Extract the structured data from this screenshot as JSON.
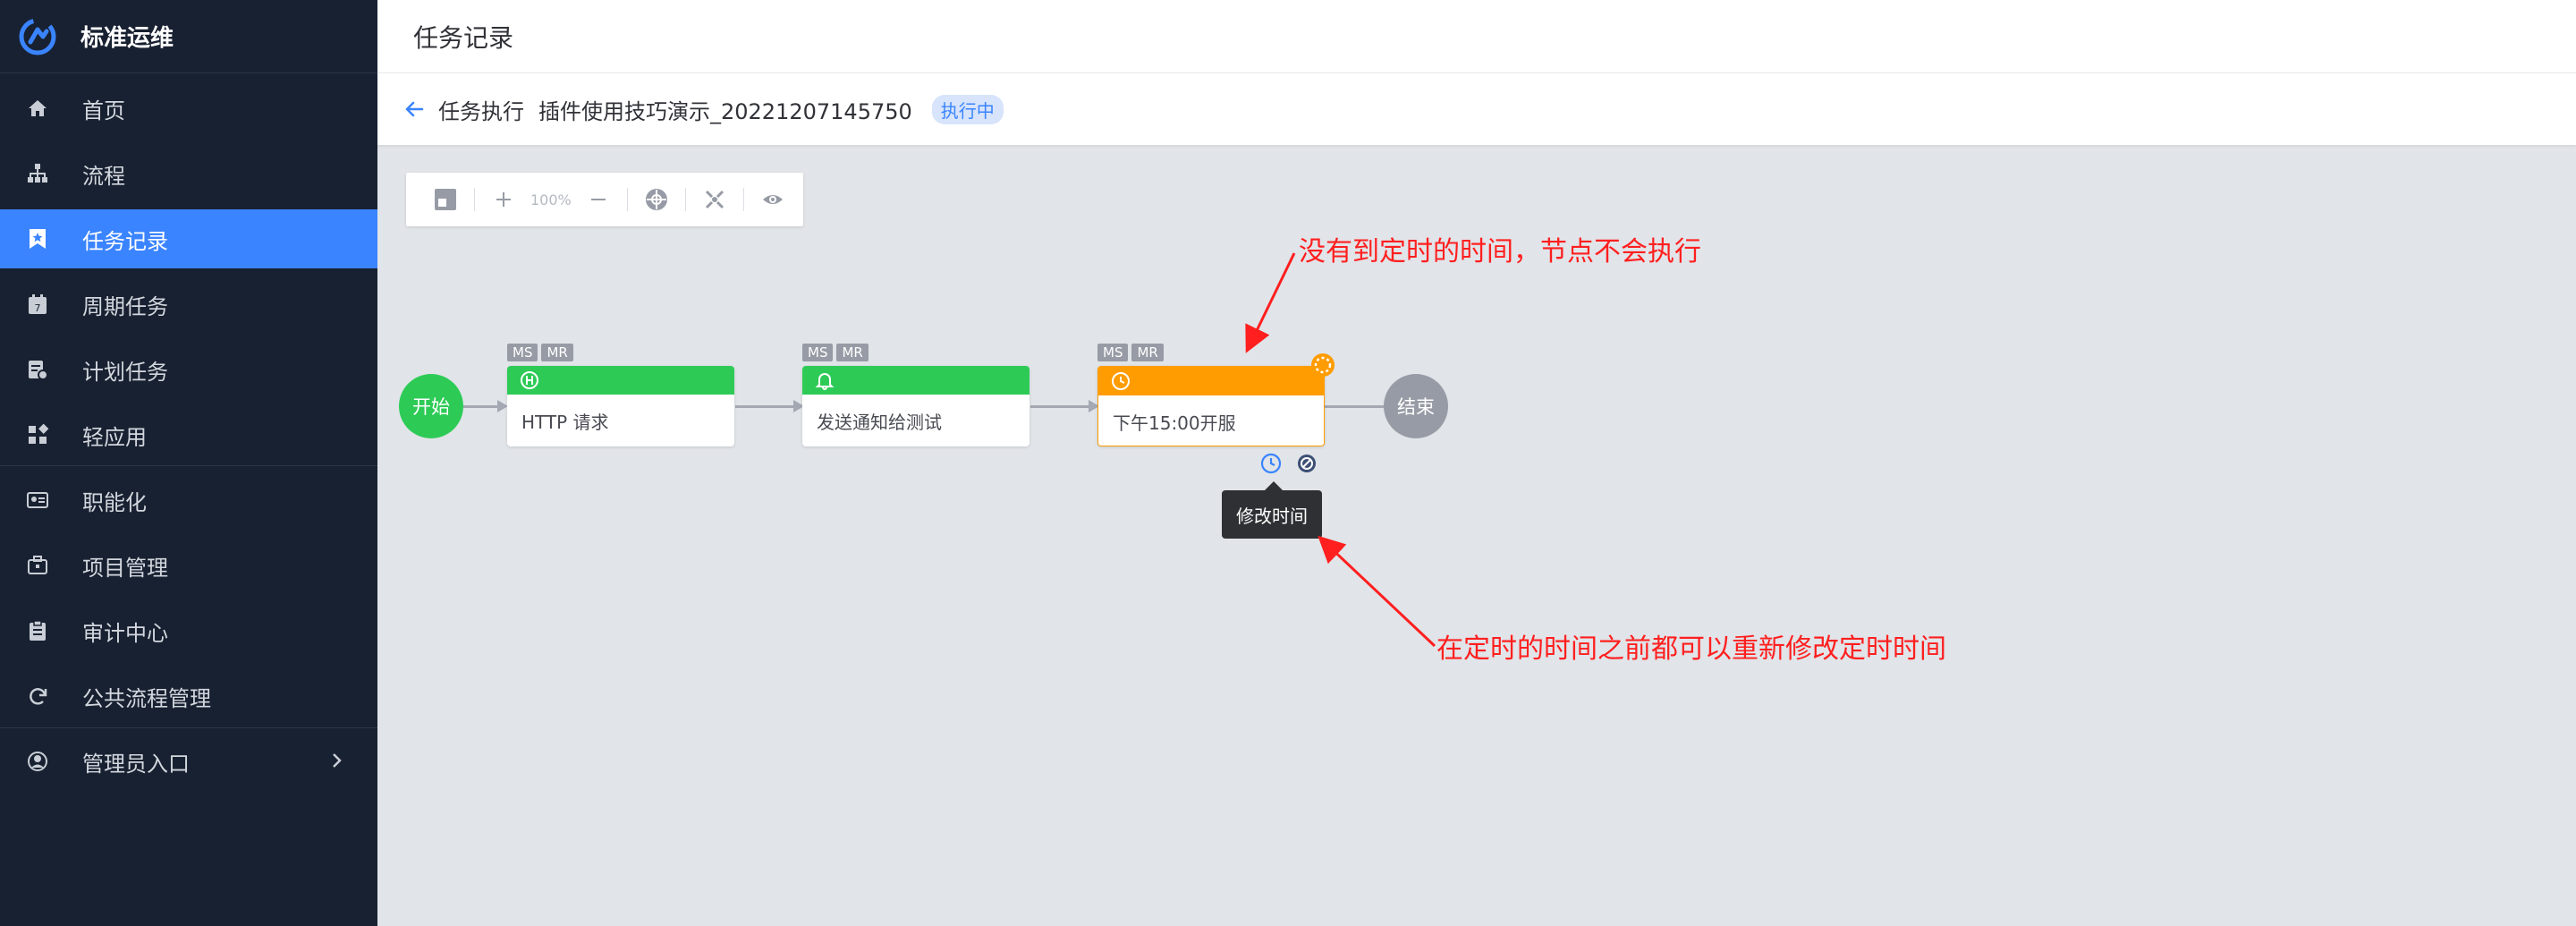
{
  "app": {
    "title": "标准运维"
  },
  "sidebar": {
    "items": [
      {
        "label": "首页",
        "icon": "home-icon"
      },
      {
        "label": "流程",
        "icon": "flow-tree-icon"
      },
      {
        "label": "任务记录",
        "icon": "bookmark-star-icon",
        "active": true
      },
      {
        "label": "周期任务",
        "icon": "calendar-icon"
      },
      {
        "label": "计划任务",
        "icon": "plan-calendar-icon"
      },
      {
        "label": "轻应用",
        "icon": "app-grid-icon"
      },
      {
        "label": "职能化",
        "icon": "id-card-icon"
      },
      {
        "label": "项目管理",
        "icon": "briefcase-icon"
      },
      {
        "label": "审计中心",
        "icon": "clipboard-icon"
      },
      {
        "label": "公共流程管理",
        "icon": "cycle-icon"
      },
      {
        "label": "管理员入口",
        "icon": "user-circle-icon"
      }
    ]
  },
  "header": {
    "title": "任务记录"
  },
  "subheader": {
    "label": "任务执行",
    "task_name": "插件使用技巧演示_20221207145750",
    "status": "执行中"
  },
  "toolbar": {
    "zoom": "100%"
  },
  "flow": {
    "start_label": "开始",
    "end_label": "结束",
    "tags": [
      "MS",
      "MR"
    ],
    "nodes": [
      {
        "name": "HTTP 请求",
        "color": "#2dcb56",
        "icon": "http-icon"
      },
      {
        "name": "发送通知给测试",
        "color": "#2dcb56",
        "icon": "bell-icon"
      },
      {
        "name": "下午15:00开服",
        "color": "#ff9c01",
        "icon": "clock-icon"
      }
    ]
  },
  "tooltip": {
    "text": "修改时间"
  },
  "annotations": {
    "top": "没有到定时的时间，节点不会执行",
    "bottom": "在定时的时间之前都可以重新修改定时时间"
  },
  "colors": {
    "sidebar_bg": "#182131",
    "accent": "#3a84ff",
    "success": "#2dcb56",
    "warning": "#ff9c01",
    "annotation": "#ff1f1f"
  }
}
